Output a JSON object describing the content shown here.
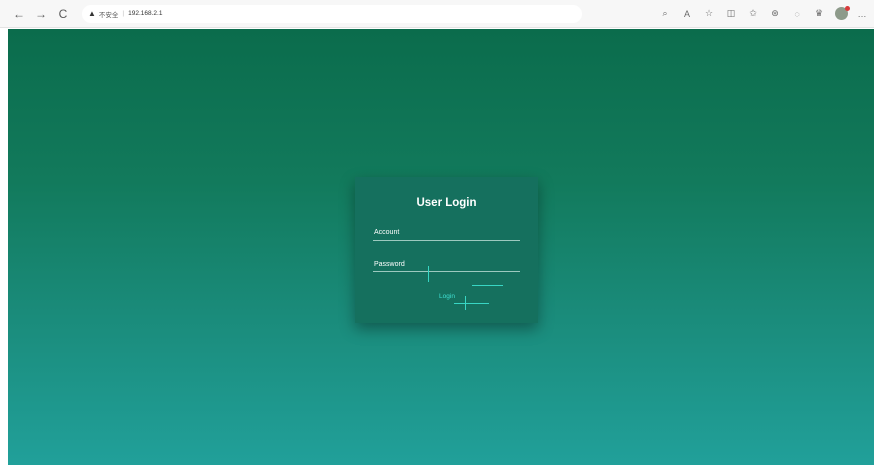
{
  "browser": {
    "back_icon": "←",
    "forward_icon": "→",
    "refresh_icon": "C",
    "warning_icon": "▲",
    "insecure_label": "不安全",
    "separator": "|",
    "url": "192.168.2.1",
    "toolbar_icons": [
      "⌕",
      "A",
      "☆",
      "◫",
      "✩",
      "⊛",
      "◌",
      "♛"
    ],
    "more_icon": "…"
  },
  "login": {
    "title": "User Login",
    "account_placeholder": "Account",
    "password_placeholder": "Password",
    "button_label": "Login"
  },
  "colors": {
    "gradient_top": "#0b6c4c",
    "gradient_bottom": "#21a09a",
    "card": "#15705e",
    "accent": "#38d6c4"
  }
}
